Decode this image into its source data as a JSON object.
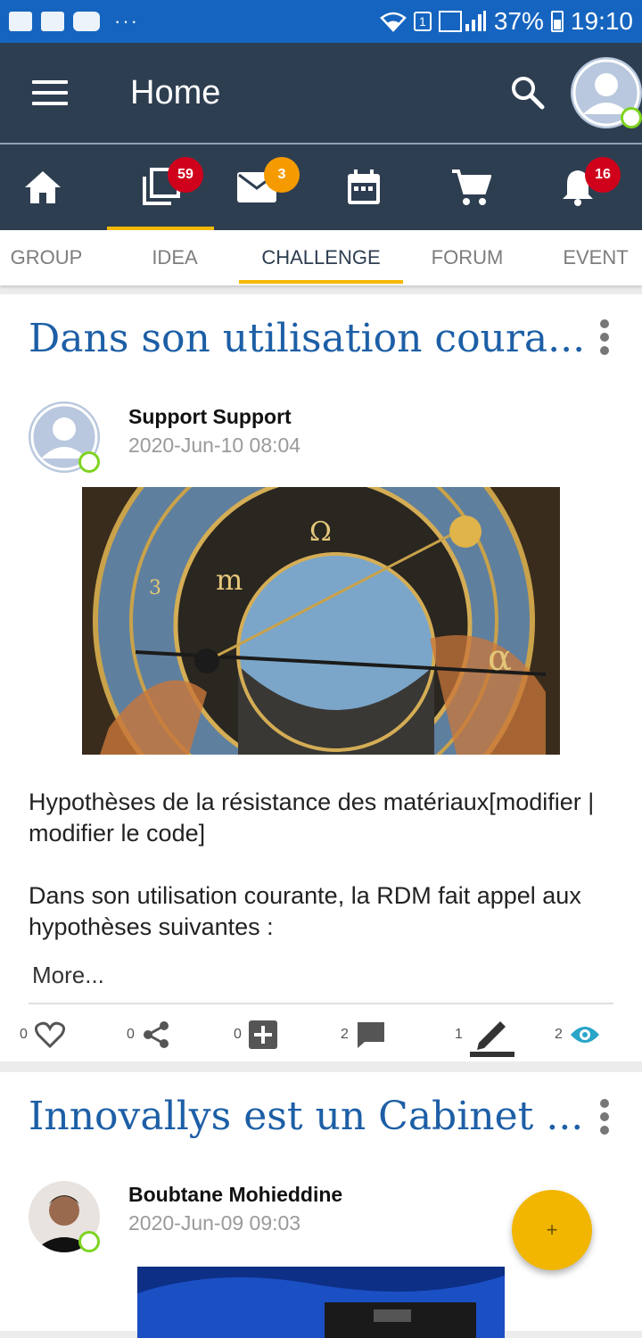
{
  "status_bar": {
    "signal_sim": "1",
    "battery": "37%",
    "time": "19:10",
    "dots": "···"
  },
  "app_bar": {
    "title": "Home"
  },
  "nav": {
    "items": [
      {
        "name": "home",
        "badge": ""
      },
      {
        "name": "ideas",
        "badge": "59"
      },
      {
        "name": "messages",
        "badge": "3"
      },
      {
        "name": "calendar",
        "badge": ""
      },
      {
        "name": "cart",
        "badge": ""
      },
      {
        "name": "notifications",
        "badge": "16"
      }
    ]
  },
  "tabs": [
    "GROUP",
    "IDEA",
    "CHALLENGE",
    "FORUM",
    "EVENT"
  ],
  "active_tab": "CHALLENGE",
  "posts": [
    {
      "title": "Dans son utilisation coura...",
      "author": "Support Support",
      "date": "2020-Jun-10 08:04",
      "body_1": "Hypothèses de la résistance des matériaux[modifier | modifier le code]",
      "body_2": "Dans son utilisation courante, la RDM fait appel aux hypothèses suivantes :",
      "more": "More...",
      "likes": "0",
      "shares": "0",
      "adds": "0",
      "comments": "2",
      "edits": "1",
      "views": "2"
    },
    {
      "title": "Innovallys est un Cabinet ...",
      "author": "Boubtane Mohieddine",
      "date": "2020-Jun-09 09:03"
    }
  ],
  "fab_label": "+",
  "colors": {
    "primary": "#2e3e51",
    "accent": "#f5b800",
    "title_blue": "#1d5fa6",
    "status_bar": "#1565c0"
  }
}
